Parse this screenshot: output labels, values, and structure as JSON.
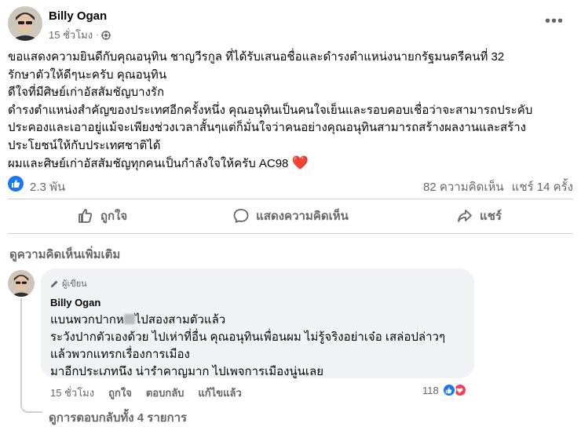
{
  "post": {
    "author": "Billy Ogan",
    "time": "15 ชั่วโมง",
    "body_lines": [
      "ขอแสดงความยินดีกับคุณอนุทิน ชาญวีรกูล ที่ได้รับเสนอชื่อและดำรงตำแหน่งนายกรัฐมนตรีคนที่ 32",
      "รักษาตัวให้ดีๆนะครับ คุณอนุทิน",
      "ดีใจที่มีศิษย์เก่าอัสสัมชัญบางรัก",
      "ดำรงตำแหน่งสำคัญของประเทศอีกครั้งหนึ่ง คุณอนุทินเป็นคนใจเย็นและรอบคอบเชื่อว่าจะสามารถประคับ",
      "ประคองและเอาอยู่แม้จะเพียงช่วงเวลาสั้นๆแต่ก็มั่นใจว่าคนอย่างคุณอนุทินสามารถสร้างผลงานและสร้าง",
      "ประโยชน์ให้กับประเทศชาติได้",
      "ผมและศิษย์เก่าอัสสัมชัญทุกคนเป็นกำลังใจให้ครับ AC98"
    ],
    "heart": "❤️"
  },
  "stats": {
    "likes": "2.3 พัน",
    "comments": "82 ความคิดเห็น",
    "shares": "แชร์ 14 ครั้ง"
  },
  "actions": {
    "like": "ถูกใจ",
    "comment": "แสดงความคิดเห็น",
    "share": "แชร์"
  },
  "more_comments": "ดูความคิดเห็นเพิ่มเติม",
  "comment": {
    "badge": "ผู้เขียน",
    "author": "Billy Ogan",
    "line1_prefix": "แบนพวกปากห",
    "line1_suffix": "ไปสองสามตัวแล้ว",
    "lines": [
      "ระวังปากตัวเองด้วย ไปเห่าที่อื่น คุณอนุทินเพื่อนผม ไม่รู้จริงอย่าเจ๋อ เสล่อปล่าวๆ",
      "แล้วพวกแทรกเรื่องการเมือง",
      "มาอีกประเภทนึง น่ารำคาญมาก ไปเพจการเมืองนู่นเลย"
    ],
    "time": "15 ชั่วโมง",
    "like": "ถูกใจ",
    "reply": "ตอบกลับ",
    "edit": "แก้ไขแล้ว",
    "reaction_count": "118"
  },
  "view_replies": "ดูการตอบกลับทั้ง 4 รายการ",
  "colors": {
    "accent": "#1877f2",
    "love": "#f33e58",
    "secondary_text": "#65676b",
    "bubble": "#f0f2f5"
  },
  "icons": [
    "globe-icon",
    "more-icon",
    "like-icon",
    "comment-icon",
    "share-icon",
    "pencil-icon",
    "love-icon"
  ]
}
